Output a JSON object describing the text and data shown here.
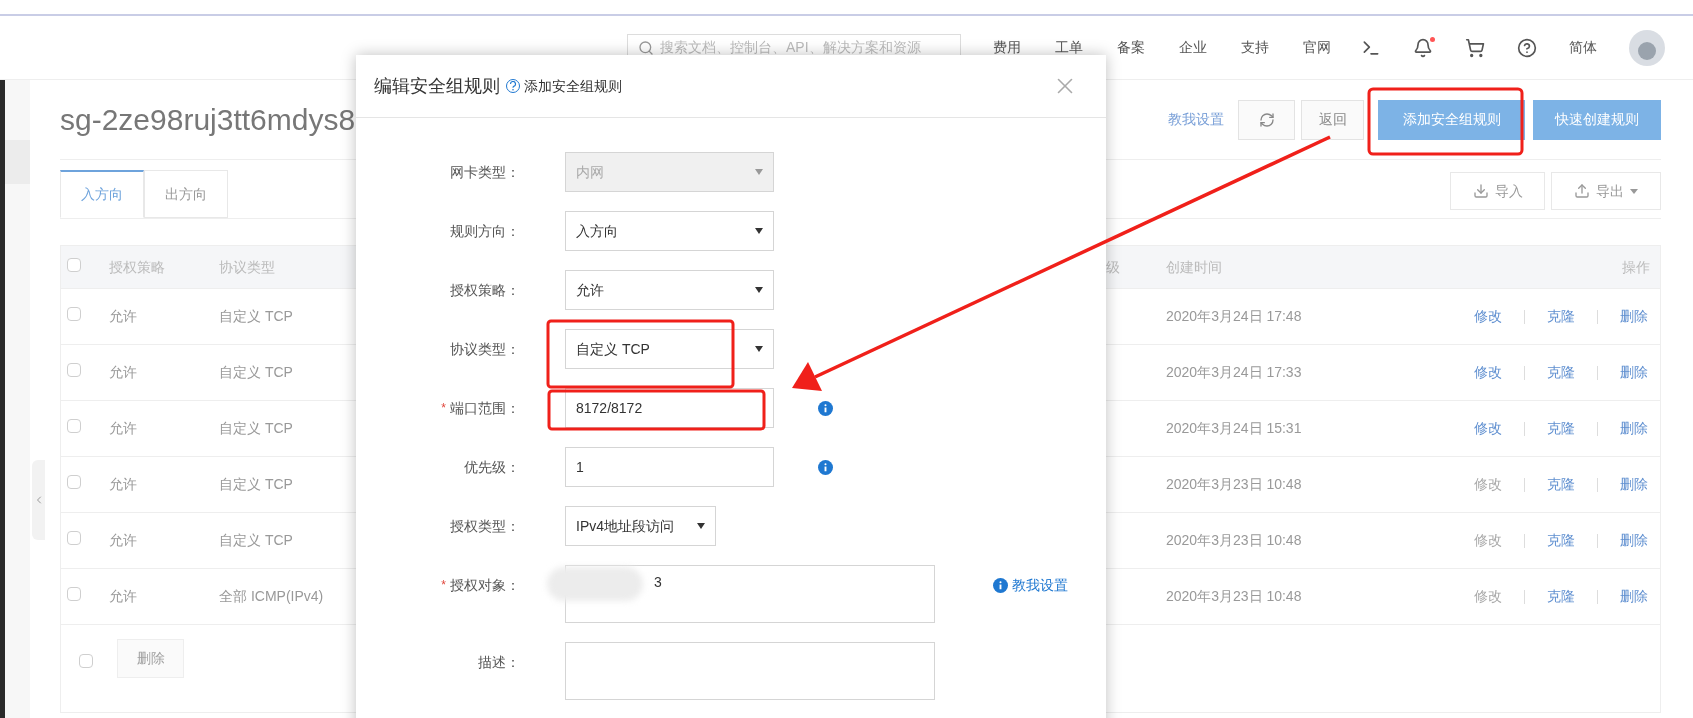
{
  "header": {
    "search": {
      "placeholder": "搜索文档、控制台、API、解决方案和资源"
    },
    "nav": [
      "费用",
      "工单",
      "备案",
      "企业",
      "支持",
      "官网"
    ],
    "notification": true,
    "language": "简体"
  },
  "page": {
    "title": "sg-2ze98ruj3tt6mdys8",
    "help_link": "教我设置",
    "back_button": "返回",
    "primary_buttons": [
      "添加安全组规则",
      "快速创建规则"
    ]
  },
  "tabs": [
    {
      "label": "入方向",
      "selected": true
    },
    {
      "label": "出方向",
      "selected": false
    }
  ],
  "toolbar": {
    "import": "导入",
    "export": "导出"
  },
  "table": {
    "select_all": {
      "checked": false
    },
    "columns": [
      "授权策略",
      "协议类型",
      "级",
      "创建时间",
      "操作"
    ],
    "rows": [
      {
        "checked": false,
        "policy": "允许",
        "protocol": "自定义 TCP",
        "created": "2020年3月24日 17:48",
        "actions": [
          {
            "label": "修改",
            "disabled": false
          },
          {
            "label": "克隆",
            "disabled": false
          },
          {
            "label": "删除",
            "disabled": false
          }
        ]
      },
      {
        "checked": false,
        "policy": "允许",
        "protocol": "自定义 TCP",
        "created": "2020年3月24日 17:33",
        "actions": [
          {
            "label": "修改",
            "disabled": false
          },
          {
            "label": "克隆",
            "disabled": false
          },
          {
            "label": "删除",
            "disabled": false
          }
        ]
      },
      {
        "checked": false,
        "policy": "允许",
        "protocol": "自定义 TCP",
        "created": "2020年3月24日 15:31",
        "actions": [
          {
            "label": "修改",
            "disabled": false
          },
          {
            "label": "克隆",
            "disabled": false
          },
          {
            "label": "删除",
            "disabled": false
          }
        ]
      },
      {
        "checked": false,
        "policy": "允许",
        "protocol": "自定义 TCP",
        "created": "2020年3月23日 10:48",
        "actions": [
          {
            "label": "修改",
            "disabled": true
          },
          {
            "label": "克隆",
            "disabled": false
          },
          {
            "label": "删除",
            "disabled": false
          }
        ]
      },
      {
        "checked": false,
        "policy": "允许",
        "protocol": "自定义 TCP",
        "created": "2020年3月23日 10:48",
        "actions": [
          {
            "label": "修改",
            "disabled": true
          },
          {
            "label": "克隆",
            "disabled": false
          },
          {
            "label": "删除",
            "disabled": false
          }
        ]
      },
      {
        "checked": false,
        "policy": "允许",
        "protocol": "全部 ICMP(IPv4)",
        "created": "2020年3月23日 10:48",
        "actions": [
          {
            "label": "修改",
            "disabled": true
          },
          {
            "label": "克隆",
            "disabled": false
          },
          {
            "label": "删除",
            "disabled": false
          }
        ]
      }
    ],
    "footer": {
      "checked": false,
      "delete_button": {
        "label": "删除",
        "disabled": true
      }
    }
  },
  "dialog": {
    "title": "编辑安全组规则",
    "subtitle": "添加安全组规则",
    "help_link": "教我设置",
    "fields": [
      {
        "label": "网卡类型：",
        "kind": "select",
        "value": "内网",
        "disabled": true,
        "info": false,
        "narrow": false,
        "redacted": false
      },
      {
        "label": "规则方向：",
        "kind": "select",
        "value": "入方向",
        "disabled": false,
        "info": false,
        "narrow": false,
        "redacted": false
      },
      {
        "label": "授权策略：",
        "kind": "select",
        "value": "允许",
        "disabled": false,
        "info": false,
        "narrow": false,
        "redacted": false
      },
      {
        "label": "协议类型：",
        "kind": "select",
        "value": "自定义 TCP",
        "disabled": false,
        "info": false,
        "narrow": false,
        "redacted": false
      },
      {
        "label": "端口范围：",
        "kind": "input",
        "value": "8172/8172",
        "disabled": false,
        "required_mark": "*",
        "info": true,
        "narrow": false,
        "redacted": false
      },
      {
        "label": "优先级：",
        "kind": "input",
        "value": "1",
        "disabled": false,
        "info": true,
        "narrow": false,
        "redacted": false
      },
      {
        "label": "授权类型：",
        "kind": "select",
        "value": "IPv4地址段访问",
        "disabled": false,
        "info": false,
        "narrow": true,
        "redacted": false
      },
      {
        "label": "授权对象：",
        "kind": "textarea",
        "value": "3",
        "disabled": false,
        "required_mark": "*",
        "info": false,
        "narrow": false,
        "redacted": true
      },
      {
        "label": "描述：",
        "kind": "textarea",
        "disabled": false,
        "info": false,
        "narrow": false,
        "redacted": false
      }
    ]
  }
}
